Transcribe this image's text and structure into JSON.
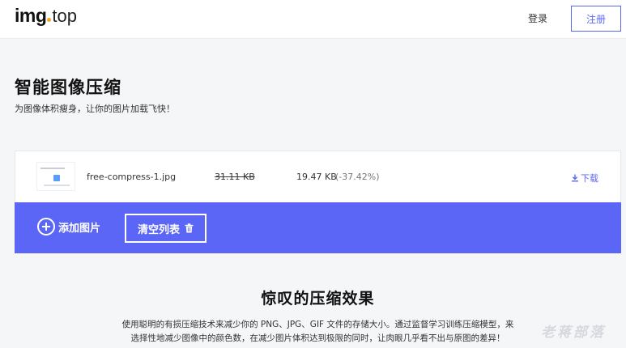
{
  "header": {
    "logo_main": "img",
    "logo_tld": "top",
    "login": "登录",
    "register": "注册"
  },
  "hero": {
    "title": "智能图像压缩",
    "subtitle": "为图像体积瘦身，让你的图片加载飞快！"
  },
  "files": [
    {
      "name": "free-compress-1.jpg",
      "original_size": "31.11 KB",
      "compressed_size": "19.47 KB",
      "reduction": "(-37.42%)",
      "download_label": "下载"
    }
  ],
  "actions": {
    "add_label": "添加图片",
    "clear_label": "清空列表"
  },
  "section": {
    "title": "惊叹的压缩效果",
    "desc_line1": "使用聪明的有损压缩技术来减少你的 PNG、JPG、GIF 文件的存储大小。通过监督学习训练压缩模型，来",
    "desc_line2": "选择性地减少图像中的颜色数，在减少图片体积达到极限的同时，让肉眼几乎看不出与原图的差异！"
  },
  "watermark": "老蒋部落",
  "colors": {
    "accent": "#5b66f6",
    "logo_dot": "#f5a623"
  }
}
